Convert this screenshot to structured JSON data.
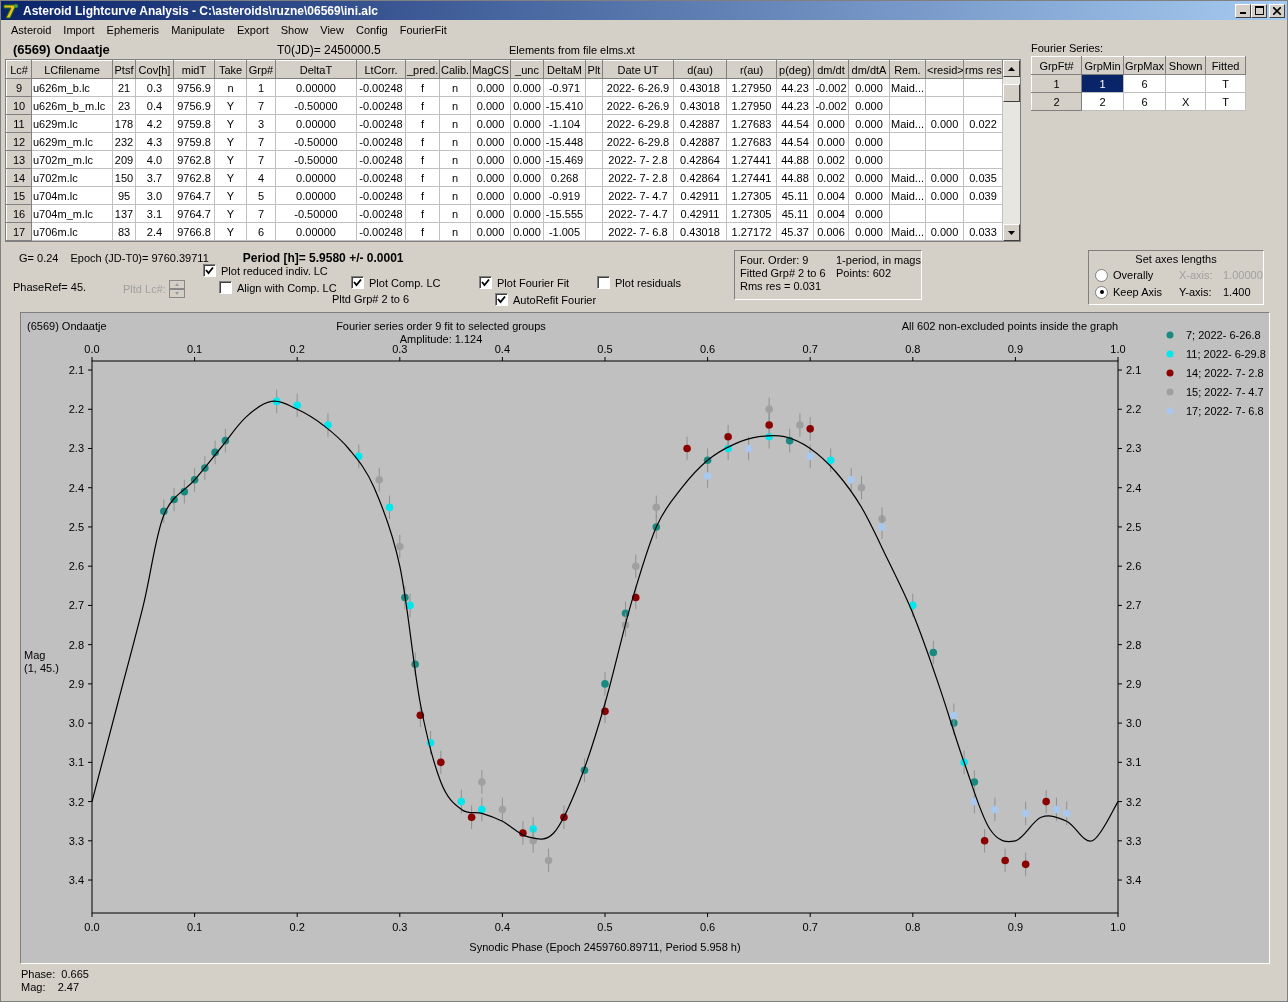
{
  "window": {
    "title": "Asteroid Lightcurve Analysis - C:\\asteroids\\ruzne\\06569\\ini.alc"
  },
  "menu": [
    "Asteroid",
    "Import",
    "Ephemeris",
    "Manipulate",
    "Export",
    "Show",
    "View",
    "Config",
    "FourierFit"
  ],
  "header": {
    "object": "(6569) Ondaatje",
    "t0": "T0(JD)= 2450000.5",
    "elements": "Elements from file elms.xt"
  },
  "table": {
    "columns": [
      "Lc#",
      "LCfilename",
      "Ptsf",
      "Cov[h]",
      "midT",
      "Take",
      "Grp#",
      "DeltaT",
      "LtCorr.",
      "_pred.",
      "Calib.",
      "MagCS",
      "_unc",
      "DeltaM",
      "Plt",
      "Date UT",
      "d(au)",
      "r(au)",
      "p(deg)",
      "dm/dt",
      "dm/dtA",
      "Rem.",
      "<resid>",
      "rms res"
    ],
    "rows": [
      {
        "cells": [
          "9",
          "u626m_b.lc",
          "21",
          "0.3",
          "9756.9",
          "n",
          "1",
          "0.00000",
          "-0.00248",
          "f",
          "n",
          "0.000",
          "0.000",
          "-0.971",
          "",
          "2022- 6-26.9",
          "0.43018",
          "1.27950",
          "44.23",
          "-0.002",
          "0.000",
          "Maid..."
        ]
      },
      {
        "cells": [
          "10",
          "u626m_b_m.lc",
          "23",
          "0.4",
          "9756.9",
          "Y",
          "7",
          "-0.50000",
          "-0.00248",
          "f",
          "n",
          "0.000",
          "0.000",
          "-15.410",
          "",
          "2022- 6-26.9",
          "0.43018",
          "1.27950",
          "44.23",
          "-0.002",
          "0.000"
        ]
      },
      {
        "cells": [
          "11",
          "u629m.lc",
          "178",
          "4.2",
          "9759.8",
          "Y",
          "3",
          "0.00000",
          "-0.00248",
          "f",
          "n",
          "0.000",
          "0.000",
          "-1.104",
          "",
          "2022- 6-29.8",
          "0.42887",
          "1.27683",
          "44.54",
          "0.000",
          "0.000",
          "Maid...",
          "0.000",
          "0.022"
        ]
      },
      {
        "cells": [
          "12",
          "u629m_m.lc",
          "232",
          "4.3",
          "9759.8",
          "Y",
          "7",
          "-0.50000",
          "-0.00248",
          "f",
          "n",
          "0.000",
          "0.000",
          "-15.448",
          "",
          "2022- 6-29.8",
          "0.42887",
          "1.27683",
          "44.54",
          "0.000",
          "0.000"
        ]
      },
      {
        "cells": [
          "13",
          "u702m_m.lc",
          "209",
          "4.0",
          "9762.8",
          "Y",
          "7",
          "-0.50000",
          "-0.00248",
          "f",
          "n",
          "0.000",
          "0.000",
          "-15.469",
          "",
          "2022- 7- 2.8",
          "0.42864",
          "1.27441",
          "44.88",
          "0.002",
          "0.000"
        ]
      },
      {
        "cells": [
          "14",
          "u702m.lc",
          "150",
          "3.7",
          "9762.8",
          "Y",
          "4",
          "0.00000",
          "-0.00248",
          "f",
          "n",
          "0.000",
          "0.000",
          "0.268",
          "",
          "2022- 7- 2.8",
          "0.42864",
          "1.27441",
          "44.88",
          "0.002",
          "0.000",
          "Maid...",
          "0.000",
          "0.035"
        ]
      },
      {
        "cells": [
          "15",
          "u704m.lc",
          "95",
          "3.0",
          "9764.7",
          "Y",
          "5",
          "0.00000",
          "-0.00248",
          "f",
          "n",
          "0.000",
          "0.000",
          "-0.919",
          "",
          "2022- 7- 4.7",
          "0.42911",
          "1.27305",
          "45.11",
          "0.004",
          "0.000",
          "Maid...",
          "0.000",
          "0.039"
        ]
      },
      {
        "cells": [
          "16",
          "u704m_m.lc",
          "137",
          "3.1",
          "9764.7",
          "Y",
          "7",
          "-0.50000",
          "-0.00248",
          "f",
          "n",
          "0.000",
          "0.000",
          "-15.555",
          "",
          "2022- 7- 4.7",
          "0.42911",
          "1.27305",
          "45.11",
          "0.004",
          "0.000"
        ]
      },
      {
        "cells": [
          "17",
          "u706m.lc",
          "83",
          "2.4",
          "9766.8",
          "Y",
          "6",
          "0.00000",
          "-0.00248",
          "f",
          "n",
          "0.000",
          "0.000",
          "-1.005",
          "",
          "2022- 7- 6.8",
          "0.43018",
          "1.27172",
          "45.37",
          "0.006",
          "0.000",
          "Maid...",
          "0.000",
          "0.033"
        ]
      }
    ]
  },
  "fourier": {
    "title": "Fourier Series:",
    "columns": [
      "GrpFt#",
      "GrpMin",
      "GrpMax",
      "Shown",
      "Fitted"
    ],
    "rows": [
      {
        "grpft": "1",
        "grpmin": "1",
        "grpmax": "6",
        "fitted": "T",
        "selected": true
      },
      {
        "grpft": "2",
        "grpmin": "2",
        "grpmax": "6",
        "shown": "X",
        "fitted": "T",
        "selected": false
      }
    ]
  },
  "info": {
    "g": "G= 0.24",
    "epoch": "Epoch (JD-T0)= 9760.39711",
    "period": "Period [h]= 5.9580 +/- 0.0001",
    "phaseref": "PhaseRef= 45.",
    "pltd_lc": {
      "label": "Pltd Lc#:",
      "disabled": true
    },
    "pltd_grp": "Pltd Grp#  2  to  6"
  },
  "checkboxes": [
    {
      "label": "Plot reduced indiv. LC",
      "checked": true
    },
    {
      "label": "Align with Comp. LC",
      "checked": false
    },
    {
      "label": "Plot Comp. LC",
      "checked": true
    },
    {
      "label": "Plot Fourier Fit",
      "checked": true
    },
    {
      "label": "AutoRefit Fourier",
      "checked": true
    },
    {
      "label": "Plot residuals",
      "checked": false
    }
  ],
  "fit_info": [
    "Four. Order:  9",
    "1-period, in mags",
    "Fitted Grp# 2 to 6",
    "Points: 602",
    "Rms res      = 0.031"
  ],
  "axes": {
    "title": "Set axes lengths",
    "options": [
      {
        "label": "Overally",
        "selected": false
      },
      {
        "label": "Keep Axis",
        "selected": true
      }
    ],
    "fields": [
      {
        "label": "X-axis:",
        "value": "1.00000",
        "disabled": true
      },
      {
        "label": "Y-axis:",
        "value": "1.400",
        "disabled": false
      }
    ]
  },
  "plot": {
    "object": "(6569) Ondaatje",
    "amplitude": "Amplitude: 1.124",
    "note": "All 602 non-excluded points inside the graph",
    "ylabel_sub": "(1, 45.)",
    "chart_data": {
      "type": "scatter",
      "title": "Fourier series order 9 fit to selected groups",
      "xlabel": "Synodic Phase (Epoch 2459760.89711, Period 5.958 h)",
      "ylabel": "Mag",
      "xlim": [
        0,
        1
      ],
      "ylim": [
        3.484,
        2.077
      ],
      "legend": true,
      "xticks": [
        {
          "value": 0,
          "label": "0.0"
        },
        {
          "value": 0.1,
          "label": "0.1"
        },
        {
          "value": 0.2,
          "label": "0.2"
        },
        {
          "value": 0.3,
          "label": "0.3"
        },
        {
          "value": 0.4,
          "label": "0.4"
        },
        {
          "value": 0.5,
          "label": "0.5"
        },
        {
          "value": 0.6,
          "label": "0.6"
        },
        {
          "value": 0.7,
          "label": "0.7"
        },
        {
          "value": 0.8,
          "label": "0.8"
        },
        {
          "value": 0.9,
          "label": "0.9"
        },
        {
          "value": 1,
          "label": "1.0"
        }
      ],
      "yticks": [
        {
          "value": 2.1,
          "label": "2.1"
        },
        {
          "value": 2.2,
          "label": "2.2"
        },
        {
          "value": 2.3,
          "label": "2.3"
        },
        {
          "value": 2.4,
          "label": "2.4"
        },
        {
          "value": 2.5,
          "label": "2.5"
        },
        {
          "value": 2.6,
          "label": "2.6"
        },
        {
          "value": 2.7,
          "label": "2.7"
        },
        {
          "value": 2.8,
          "label": "2.8"
        },
        {
          "value": 2.9,
          "label": "2.9"
        },
        {
          "value": 3.0,
          "label": "3.0"
        },
        {
          "value": 3.1,
          "label": "3.1"
        },
        {
          "value": 3.2,
          "label": "3.2"
        },
        {
          "value": 3.3,
          "label": "3.3"
        },
        {
          "value": 3.4,
          "label": "3.4"
        }
      ],
      "series": [
        {
          "name": "7; 2022- 6-26.8",
          "color": "#1a8a80",
          "type": "scatter",
          "x": [
            0.07,
            0.08,
            0.09,
            0.1,
            0.11,
            0.12,
            0.13,
            0.305,
            0.315,
            0.48,
            0.5,
            0.52,
            0.55,
            0.6,
            0.68,
            0.82,
            0.84,
            0.86
          ],
          "values": [
            2.46,
            2.43,
            2.41,
            2.38,
            2.35,
            2.31,
            2.28,
            2.68,
            2.85,
            3.12,
            2.9,
            2.72,
            2.5,
            2.33,
            2.28,
            2.82,
            3.0,
            3.15
          ],
          "errors": [
            0.03,
            0.03,
            0.03,
            0.03,
            0.03,
            0.03,
            0.03,
            0.03,
            0.03,
            0.03,
            0.03,
            0.03,
            0.03,
            0.03,
            0.03,
            0.03,
            0.03,
            0.03
          ]
        },
        {
          "name": "11; 2022- 6-29.8",
          "color": "#00e8ee",
          "type": "scatter",
          "x": [
            0.18,
            0.2,
            0.23,
            0.26,
            0.29,
            0.31,
            0.33,
            0.36,
            0.38,
            0.43,
            0.62,
            0.66,
            0.72,
            0.8,
            0.85
          ],
          "values": [
            2.18,
            2.19,
            2.24,
            2.32,
            2.45,
            2.7,
            3.05,
            3.2,
            3.22,
            3.27,
            2.3,
            2.27,
            2.33,
            2.7,
            3.1
          ],
          "errors": [
            0.03,
            0.03,
            0.03,
            0.03,
            0.03,
            0.03,
            0.03,
            0.03,
            0.03,
            0.03,
            0.03,
            0.03,
            0.03,
            0.03,
            0.03
          ]
        },
        {
          "name": "14; 2022- 7- 2.8",
          "color": "#8b0000",
          "type": "scatter",
          "x": [
            0.32,
            0.34,
            0.37,
            0.42,
            0.46,
            0.5,
            0.53,
            0.58,
            0.62,
            0.66,
            0.7,
            0.87,
            0.89,
            0.91,
            0.93
          ],
          "values": [
            2.98,
            3.1,
            3.24,
            3.28,
            3.24,
            2.97,
            2.68,
            2.3,
            2.27,
            2.24,
            2.25,
            3.3,
            3.35,
            3.36,
            3.2
          ],
          "errors": [
            0.03,
            0.03,
            0.03,
            0.03,
            0.03,
            0.03,
            0.03,
            0.03,
            0.03,
            0.03,
            0.03,
            0.03,
            0.03,
            0.03,
            0.03
          ]
        },
        {
          "name": "15; 2022- 7- 4.7",
          "color": "#a0a0a0",
          "type": "scatter",
          "x": [
            0.28,
            0.3,
            0.38,
            0.4,
            0.43,
            0.445,
            0.52,
            0.53,
            0.55,
            0.66,
            0.69,
            0.75,
            0.77
          ],
          "values": [
            2.38,
            2.55,
            3.15,
            3.22,
            3.3,
            3.35,
            2.75,
            2.6,
            2.45,
            2.2,
            2.24,
            2.4,
            2.48
          ],
          "errors": [
            0.03,
            0.03,
            0.03,
            0.03,
            0.03,
            0.03,
            0.03,
            0.03,
            0.03,
            0.03,
            0.03,
            0.03,
            0.03
          ]
        },
        {
          "name": "17; 2022- 7- 6.8",
          "color": "#a8c8f0",
          "type": "scatter",
          "x": [
            0.6,
            0.64,
            0.7,
            0.74,
            0.77,
            0.84,
            0.86,
            0.88,
            0.91,
            0.94,
            0.95
          ],
          "values": [
            2.37,
            2.3,
            2.32,
            2.38,
            2.5,
            2.98,
            3.2,
            3.22,
            3.23,
            3.22,
            3.23
          ],
          "errors": [
            0.03,
            0.03,
            0.03,
            0.03,
            0.03,
            0.03,
            0.03,
            0.03,
            0.03,
            0.03,
            0.03
          ]
        },
        {
          "color": "#000000",
          "type": "line",
          "x": [
            0,
            0.025,
            0.05,
            0.07,
            0.1,
            0.125,
            0.15,
            0.175,
            0.2,
            0.225,
            0.25,
            0.275,
            0.3,
            0.32,
            0.34,
            0.36,
            0.38,
            0.4,
            0.425,
            0.45,
            0.475,
            0.5,
            0.525,
            0.55,
            0.575,
            0.6,
            0.625,
            0.65,
            0.675,
            0.7,
            0.725,
            0.75,
            0.775,
            0.8,
            0.825,
            0.85,
            0.875,
            0.9,
            0.925,
            0.95,
            0.975,
            1
          ],
          "values": [
            3.2,
            2.95,
            2.7,
            2.47,
            2.38,
            2.3,
            2.22,
            2.18,
            2.2,
            2.24,
            2.3,
            2.4,
            2.6,
            2.95,
            3.15,
            3.22,
            3.23,
            3.25,
            3.29,
            3.28,
            3.15,
            2.95,
            2.7,
            2.5,
            2.4,
            2.33,
            2.29,
            2.27,
            2.27,
            2.3,
            2.36,
            2.45,
            2.58,
            2.72,
            2.9,
            3.1,
            3.27,
            3.3,
            3.24,
            3.25,
            3.3,
            3.2
          ]
        }
      ]
    }
  },
  "status": [
    "Phase:  0.665",
    "Mag:    2.47"
  ]
}
